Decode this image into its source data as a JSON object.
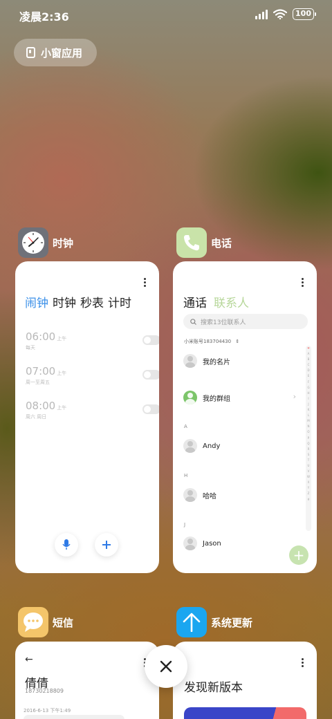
{
  "status_bar": {
    "time": "凌晨2:36",
    "battery": "100"
  },
  "float_window": {
    "label": "小窗应用"
  },
  "apps": {
    "clock": {
      "name": "时钟",
      "tabs": [
        "闹钟",
        "时钟",
        "秒表",
        "计时"
      ],
      "alarms": [
        {
          "time": "06:00",
          "period": "上午",
          "repeat": "每天"
        },
        {
          "time": "07:00",
          "period": "上午",
          "repeat": "周一至周五"
        },
        {
          "time": "08:00",
          "period": "上午",
          "repeat": "周六 周日"
        }
      ],
      "add_icon": "plus-icon",
      "voice_icon": "mic-icon"
    },
    "phone": {
      "name": "电话",
      "tabs": [
        "通话",
        "联系人"
      ],
      "search_placeholder": "搜索13位联系人",
      "account": "小米账号183704430",
      "contacts": [
        {
          "label": "我的名片"
        },
        {
          "label": "我的群组"
        }
      ],
      "sections": [
        {
          "letter": "A",
          "name": "Andy"
        },
        {
          "letter": "H",
          "name": "哈哈"
        },
        {
          "letter": "J",
          "name": "Jason"
        }
      ],
      "alphabet": "❤ABCDEFGHIJKLMNOPQRSTUVWXYZ#",
      "accent": "#7cc56a"
    },
    "sms": {
      "name": "短信",
      "contact_name": "倩倩",
      "contact_number": "18730218809",
      "date": "2016-6-13 下午1:49"
    },
    "update": {
      "name": "系统更新",
      "headline": "发现新版本"
    }
  }
}
